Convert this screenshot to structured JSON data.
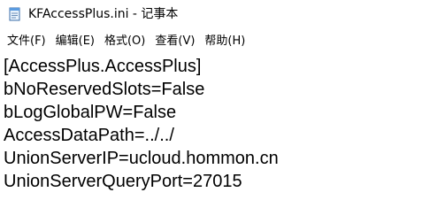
{
  "window": {
    "title": "KFAccessPlus.ini - 记事本",
    "icon": "notepad-icon"
  },
  "menu": {
    "items": [
      {
        "label": "文件(F)"
      },
      {
        "label": "编辑(E)"
      },
      {
        "label": "格式(O)"
      },
      {
        "label": "查看(V)"
      },
      {
        "label": "帮助(H)"
      }
    ]
  },
  "editor": {
    "lines": [
      "[AccessPlus.AccessPlus]",
      "bNoReservedSlots=False",
      "bLogGlobalPW=False",
      "AccessDataPath=../../",
      "UnionServerIP=ucloud.hommon.cn",
      "UnionServerQueryPort=27015"
    ]
  }
}
